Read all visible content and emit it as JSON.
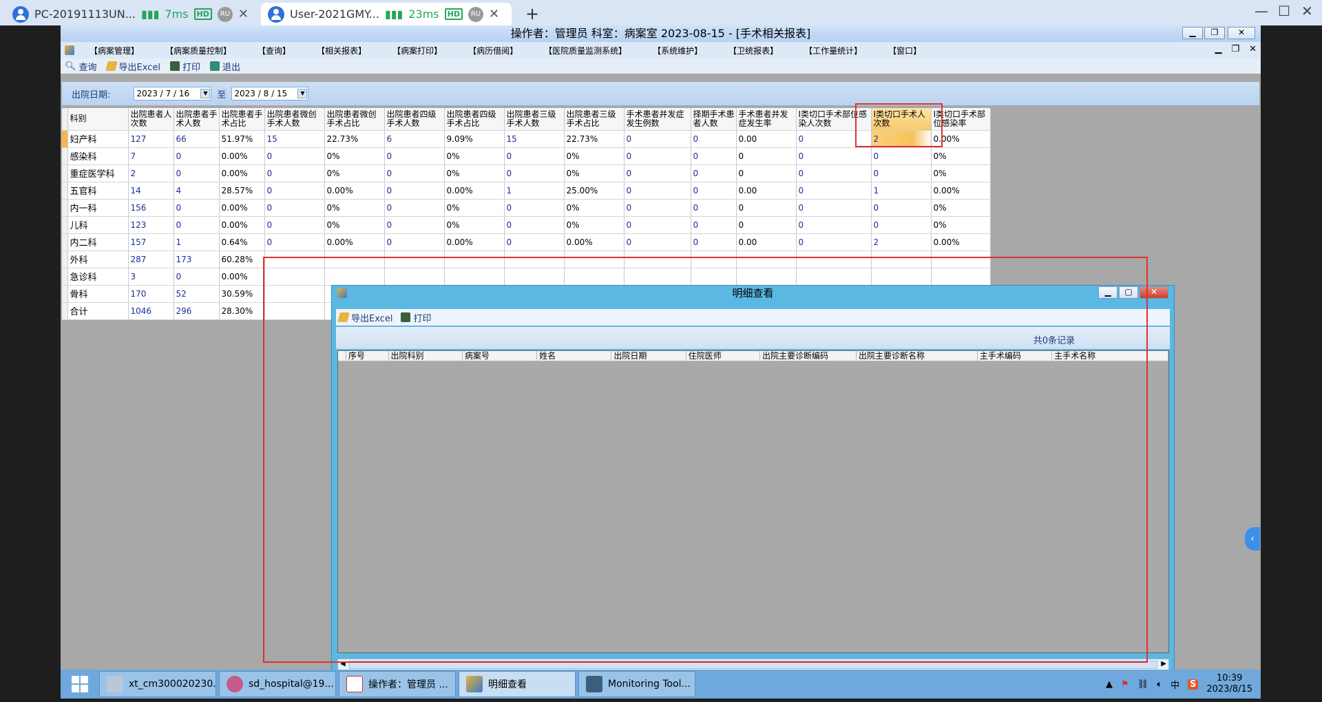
{
  "rd_tabs": [
    {
      "title": "PC-20191113UN...",
      "ping": "7ms",
      "hd": "HD",
      "user": "RU"
    },
    {
      "title": "User-2021GMY...",
      "ping": "23ms",
      "hd": "HD",
      "user": "RU"
    }
  ],
  "rd_controls": {
    "new_tab": "+",
    "minimize": "—",
    "maximize": "☐",
    "close": "✕"
  },
  "app": {
    "title": "操作者：管理员  科室：病案室  2023-08-15 - [手术相关报表]",
    "menu": [
      "【病案管理】",
      "【病案质量控制】",
      "【查询】",
      "【相关报表】",
      "【病案打印】",
      "【病历借阅】",
      "【医院质量监测系统】",
      "【系统维护】",
      "【卫统报表】",
      "【工作量统计】",
      "【窗口】"
    ],
    "toolbar": {
      "query": "查询",
      "export": "导出Excel",
      "print": "打印",
      "exit": "退出"
    },
    "filter": {
      "label": "出院日期:",
      "from": "2023 / 7 / 16",
      "to_label": "至",
      "to": "2023 / 8 / 15"
    }
  },
  "grid": {
    "headers": [
      "科别",
      "出院患者人次数",
      "出院患者手术人数",
      "出院患者手术占比",
      "出院患者微创手术人数",
      "出院患者微创手术占比",
      "出院患者四级手术人数",
      "出院患者四级手术占比",
      "出院患者三级手术人数",
      "出院患者三级手术占比",
      "手术患者并发症发生例数",
      "择期手术患者人数",
      "手术患者并发症发生率",
      "Ⅰ类切口手术部位感染人次数",
      "Ⅰ类切口手术人次数",
      "Ⅰ类切口手术部位感染率"
    ],
    "rows": [
      [
        "妇产科",
        "127",
        "66",
        "51.97%",
        "15",
        "22.73%",
        "6",
        "9.09%",
        "15",
        "22.73%",
        "0",
        "0",
        "0.00",
        "0",
        "2",
        "0.00%"
      ],
      [
        "感染科",
        "7",
        "0",
        "0.00%",
        "0",
        "0%",
        "0",
        "0%",
        "0",
        "0%",
        "0",
        "0",
        "0",
        "0",
        "0",
        "0%"
      ],
      [
        "重症医学科",
        "2",
        "0",
        "0.00%",
        "0",
        "0%",
        "0",
        "0%",
        "0",
        "0%",
        "0",
        "0",
        "0",
        "0",
        "0",
        "0%"
      ],
      [
        "五官科",
        "14",
        "4",
        "28.57%",
        "0",
        "0.00%",
        "0",
        "0.00%",
        "1",
        "25.00%",
        "0",
        "0",
        "0.00",
        "0",
        "1",
        "0.00%"
      ],
      [
        "内一科",
        "156",
        "0",
        "0.00%",
        "0",
        "0%",
        "0",
        "0%",
        "0",
        "0%",
        "0",
        "0",
        "0",
        "0",
        "0",
        "0%"
      ],
      [
        "儿科",
        "123",
        "0",
        "0.00%",
        "0",
        "0%",
        "0",
        "0%",
        "0",
        "0%",
        "0",
        "0",
        "0",
        "0",
        "0",
        "0%"
      ],
      [
        "内二科",
        "157",
        "1",
        "0.64%",
        "0",
        "0.00%",
        "0",
        "0.00%",
        "0",
        "0.00%",
        "0",
        "0",
        "0.00",
        "0",
        "2",
        "0.00%"
      ],
      [
        "外科",
        "287",
        "173",
        "60.28%",
        "",
        "",
        "",
        "",
        "",
        "",
        "",
        "",
        "",
        "",
        "",
        ""
      ],
      [
        "急诊科",
        "3",
        "0",
        "0.00%",
        "",
        "",
        "",
        "",
        "",
        "",
        "",
        "",
        "",
        "",
        "",
        ""
      ],
      [
        "骨科",
        "170",
        "52",
        "30.59%",
        "",
        "",
        "",
        "",
        "",
        "",
        "",
        "",
        "",
        "",
        "",
        ""
      ],
      [
        "合计",
        "1046",
        "296",
        "28.30%",
        "",
        "",
        "",
        "",
        "",
        "",
        "",
        "",
        "",
        "",
        "",
        ""
      ]
    ]
  },
  "dialog": {
    "title": "明细查看",
    "export": "导出Excel",
    "print": "打印",
    "count": "共0条记录",
    "columns": [
      "序号",
      "出院科别",
      "病案号",
      "姓名",
      "出院日期",
      "住院医师",
      "出院主要诊断编码",
      "出院主要诊断名称",
      "主手术编码",
      "主手术名称"
    ]
  },
  "side_tab": "‹",
  "taskbar": {
    "items": [
      "xt_cm300020230...",
      "sd_hospital@19...",
      "操作者：管理员 ...",
      "明细查看",
      "Monitoring Tool..."
    ],
    "time": "10:39",
    "date": "2023/8/15",
    "ime": "中",
    "sogou": "S"
  }
}
